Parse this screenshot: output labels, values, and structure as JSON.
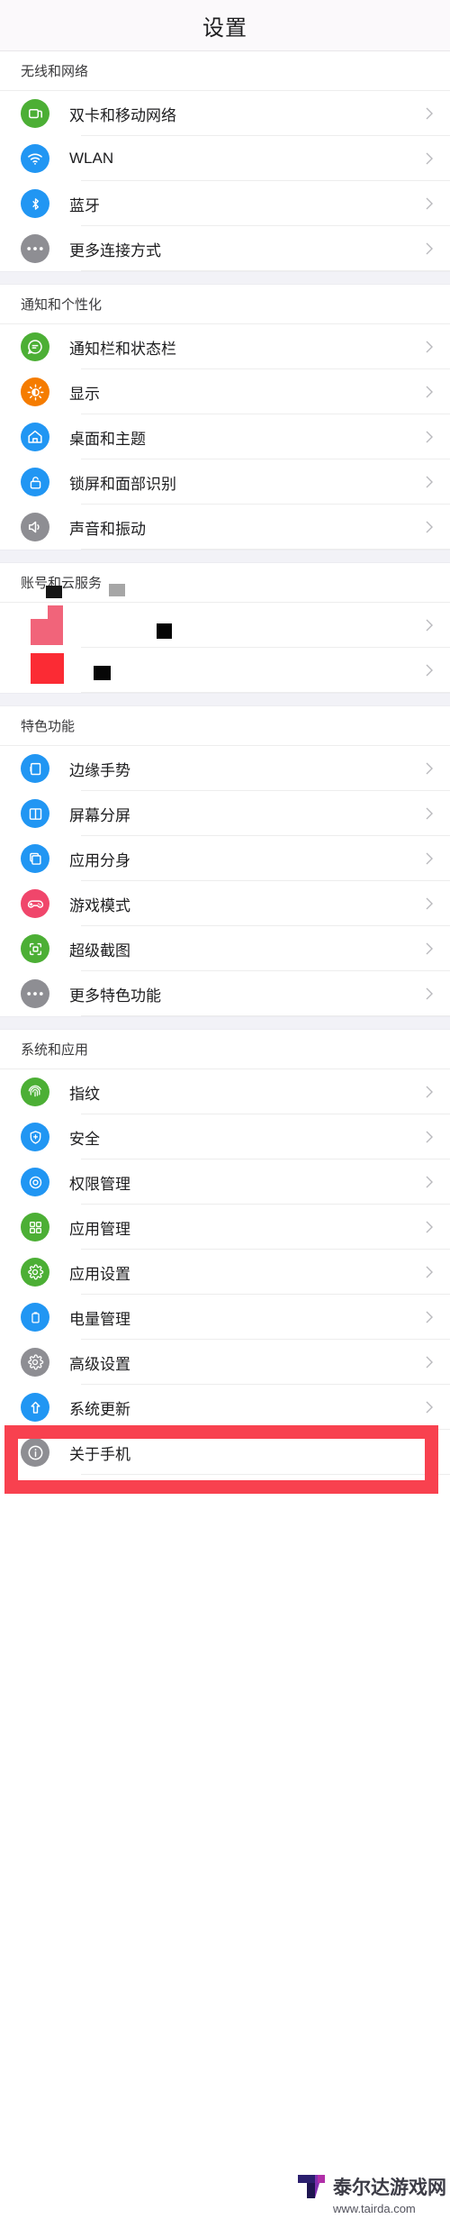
{
  "header": {
    "title": "设置"
  },
  "accent": {
    "highlight": "#f8414f",
    "divider": "#ededed",
    "group_bg": "#f2f2f7"
  },
  "groups": [
    {
      "title": "无线和网络",
      "items": [
        {
          "label": "双卡和移动网络",
          "icon": "sim-card-icon",
          "icon_color": "#4caf35",
          "glitch": false
        },
        {
          "label": "WLAN",
          "icon": "wifi-icon",
          "icon_color": "#2196f3",
          "glitch": false
        },
        {
          "label": "蓝牙",
          "icon": "bluetooth-icon",
          "icon_color": "#2196f3",
          "glitch": false
        },
        {
          "label": "更多连接方式",
          "icon": "more-dots-icon",
          "icon_color": "#8e8e93",
          "glitch": false
        }
      ]
    },
    {
      "title": "通知和个性化",
      "items": [
        {
          "label": "通知栏和状态栏",
          "icon": "chat-bubble-icon",
          "icon_color": "#4caf35",
          "glitch": false
        },
        {
          "label": "显示",
          "icon": "brightness-icon",
          "icon_color": "#f57c00",
          "glitch": false
        },
        {
          "label": "桌面和主题",
          "icon": "home-icon",
          "icon_color": "#2196f3",
          "glitch": false
        },
        {
          "label": "锁屏和面部识别",
          "icon": "lock-icon",
          "icon_color": "#2196f3",
          "glitch": false
        },
        {
          "label": "声音和振动",
          "icon": "speaker-icon",
          "icon_color": "#8e8e93",
          "glitch": false
        }
      ]
    },
    {
      "title": "账号和云服务",
      "items": [
        {
          "label": "",
          "icon": "corrupted-icon",
          "icon_color": "#ffffff",
          "glitch": true
        },
        {
          "label": "",
          "icon": "corrupted-icon",
          "icon_color": "#ffffff",
          "glitch": true
        }
      ]
    },
    {
      "title": "特色功能",
      "items": [
        {
          "label": "边缘手势",
          "icon": "edge-gesture-icon",
          "icon_color": "#2196f3",
          "glitch": false
        },
        {
          "label": "屏幕分屏",
          "icon": "split-screen-icon",
          "icon_color": "#2196f3",
          "glitch": false
        },
        {
          "label": "应用分身",
          "icon": "app-clone-icon",
          "icon_color": "#2196f3",
          "glitch": false
        },
        {
          "label": "游戏模式",
          "icon": "gamepad-icon",
          "icon_color": "#f0466b",
          "glitch": false
        },
        {
          "label": "超级截图",
          "icon": "screenshot-icon",
          "icon_color": "#4caf35",
          "glitch": false
        },
        {
          "label": "更多特色功能",
          "icon": "more-dots-icon",
          "icon_color": "#8e8e93",
          "glitch": false
        }
      ]
    },
    {
      "title": "系统和应用",
      "items": [
        {
          "label": "指纹",
          "icon": "fingerprint-icon",
          "icon_color": "#4caf35",
          "glitch": false
        },
        {
          "label": "安全",
          "icon": "shield-icon",
          "icon_color": "#2196f3",
          "glitch": false
        },
        {
          "label": "权限管理",
          "icon": "permission-icon",
          "icon_color": "#2196f3",
          "glitch": false
        },
        {
          "label": "应用管理",
          "icon": "apps-grid-icon",
          "icon_color": "#4caf35",
          "glitch": false
        },
        {
          "label": "应用设置",
          "icon": "gear-icon",
          "icon_color": "#4caf35",
          "glitch": false
        },
        {
          "label": "电量管理",
          "icon": "battery-icon",
          "icon_color": "#2196f3",
          "glitch": false
        },
        {
          "label": "高级设置",
          "icon": "gear-icon",
          "icon_color": "#8e8e93",
          "glitch": false
        },
        {
          "label": "系统更新",
          "icon": "upload-arrow-icon",
          "icon_color": "#2196f3",
          "glitch": false
        },
        {
          "label": "关于手机",
          "icon": "info-icon",
          "icon_color": "#8e8e93",
          "glitch": false,
          "highlighted": true
        }
      ]
    }
  ],
  "watermark": {
    "name": "泰尔达游戏网",
    "url": "www.tairda.com"
  }
}
